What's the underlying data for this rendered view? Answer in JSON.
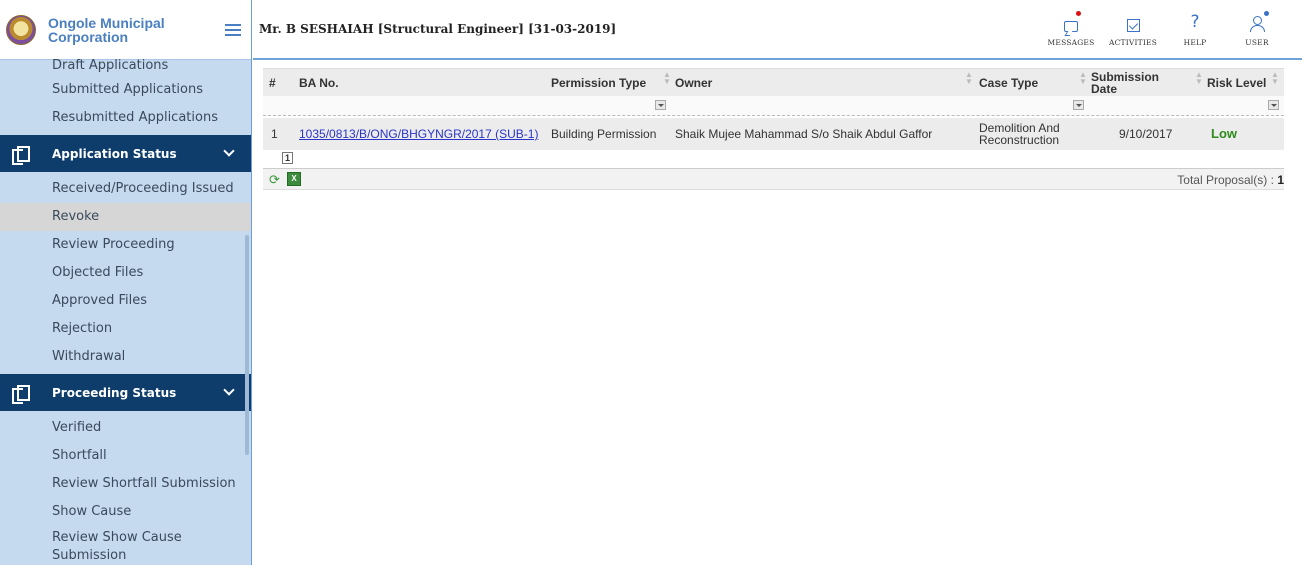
{
  "brand": {
    "name": "Ongole Municipal Corporation"
  },
  "header": {
    "user_title": "Mr. B SESHAIAH [Structural Engineer] [31-03-2019]",
    "actions": [
      {
        "label": "MESSAGES",
        "icon": "message-icon"
      },
      {
        "label": "ACTIVITIES",
        "icon": "check-square-icon"
      },
      {
        "label": "HELP",
        "icon": "question-icon"
      },
      {
        "label": "USER",
        "icon": "user-icon"
      }
    ],
    "help_glyph": "?"
  },
  "sidebar": {
    "top_items": [
      "Draft Applications",
      "Submitted Applications",
      "Resubmitted Applications"
    ],
    "sections": [
      {
        "title": "Application Status",
        "items": [
          "Received/Proceeding Issued",
          "Revoke",
          "Review Proceeding",
          "Objected Files",
          "Approved Files",
          "Rejection",
          "Withdrawal"
        ]
      },
      {
        "title": "Proceeding Status",
        "items": [
          "Verified",
          "Shortfall",
          "Review Shortfall Submission",
          "Show Cause",
          "Review Show Cause Submission"
        ]
      }
    ],
    "active_item": "Revoke"
  },
  "grid": {
    "columns": {
      "num": "#",
      "ba_no": "BA No.",
      "permission_type": "Permission Type",
      "owner": "Owner",
      "case_type": "Case Type",
      "submission_date": "Submission Date",
      "risk_level": "Risk Level"
    },
    "rows": [
      {
        "num": "1",
        "ba_no": "1035/0813/B/ONG/BHGYNGR/2017 (SUB-1)",
        "permission_type": "Building Permission",
        "owner": "Shaik Mujee Mahammad S/o Shaik Abdul Gaffor",
        "case_type": "Demolition And Reconstruction",
        "submission_date": "9/10/2017",
        "risk_level": "Low"
      }
    ],
    "page": "1",
    "total_label": "Total Proposal(s) :",
    "total_count": "1",
    "export_glyph": "X"
  }
}
